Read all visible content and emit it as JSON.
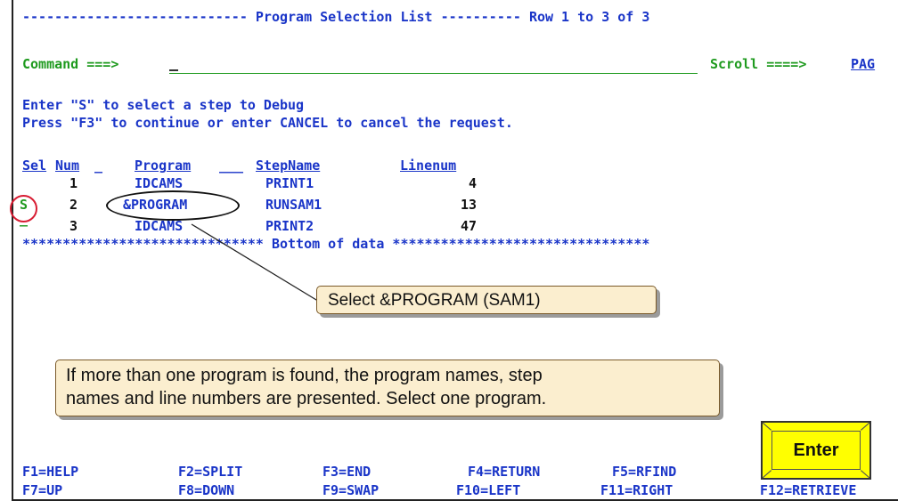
{
  "header": {
    "title_line": "---------------------------- Program Selection List ---------- Row 1 to 3 of 3"
  },
  "command": {
    "label": "Command ===>",
    "scroll_label": "Scroll ====>",
    "scroll_value": "PAG"
  },
  "instructions": {
    "line1": "Enter \"S\" to select a step to Debug",
    "line2": "Press \"F3\" to continue or enter CANCEL to cancel the request."
  },
  "table": {
    "columns": [
      "Sel",
      "Num",
      "Program",
      "StepName",
      "Linenum"
    ],
    "rows": [
      {
        "sel": "",
        "num": "1",
        "program": "IDCAMS",
        "stepname": "PRINT1",
        "linenum": "4"
      },
      {
        "sel": "S",
        "num": "2",
        "program": "&PROGRAM",
        "stepname": "RUNSAM1",
        "linenum": "13"
      },
      {
        "sel": "",
        "num": "3",
        "program": "IDCAMS",
        "stepname": "PRINT2",
        "linenum": "47"
      }
    ],
    "bottom_line": "****************************** Bottom of data ********************************"
  },
  "callouts": {
    "select_program": "Select &PROGRAM (SAM1)",
    "info_line1": "If more than one program is found, the program names, step",
    "info_line2": "names and line numbers are presented. Select one program."
  },
  "enter_button": {
    "label": "Enter"
  },
  "function_keys": {
    "row1": [
      "F1=HELP",
      "F2=SPLIT",
      "F3=END",
      "F4=RETURN",
      "F5=RFIND",
      ""
    ],
    "row2": [
      "F7=UP",
      "F8=DOWN",
      "F9=SWAP",
      "F10=LEFT",
      "F11=RIGHT",
      "F12=RETRIEVE"
    ]
  },
  "colors": {
    "text_blue": "#1a35c8",
    "text_green": "#1e9a1e",
    "highlight_red": "#d81d33",
    "callout_bg": "#fbeecf",
    "button_yellow": "#ffff00"
  }
}
